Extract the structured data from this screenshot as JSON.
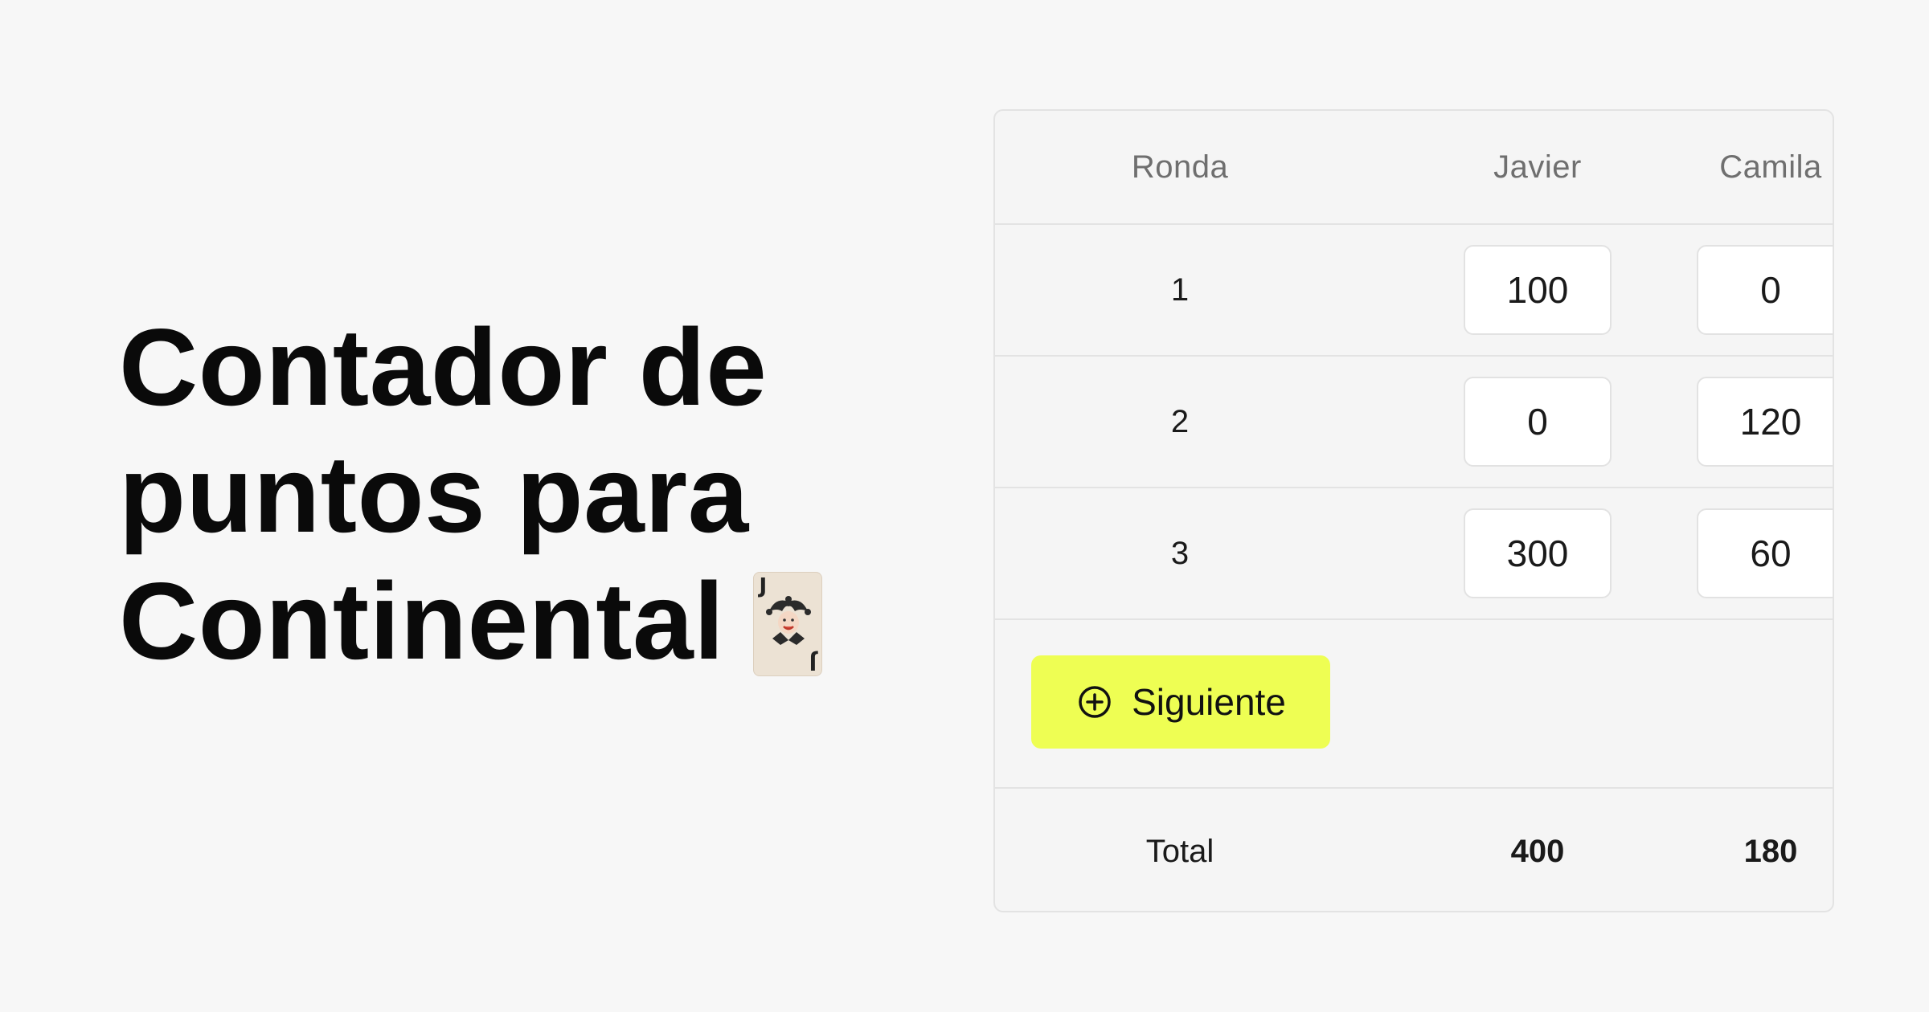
{
  "hero": {
    "title_lines": [
      "Contador de",
      "puntos para",
      "Continental"
    ],
    "card_rank": "J"
  },
  "table": {
    "headers": {
      "round": "Ronda",
      "players": [
        "Javier",
        "Camila"
      ]
    },
    "rounds": [
      {
        "round": "1",
        "scores": [
          "100",
          "0"
        ]
      },
      {
        "round": "2",
        "scores": [
          "0",
          "120"
        ]
      },
      {
        "round": "3",
        "scores": [
          "300",
          "60"
        ]
      }
    ],
    "next_button_label": "Siguiente",
    "next_button_icon": "plus-circle-icon",
    "total_label": "Total",
    "totals": [
      "400",
      "180"
    ]
  },
  "colors": {
    "background": "#f7f7f7",
    "button_accent": "#eefe53",
    "header_text": "#6f6f6f"
  }
}
